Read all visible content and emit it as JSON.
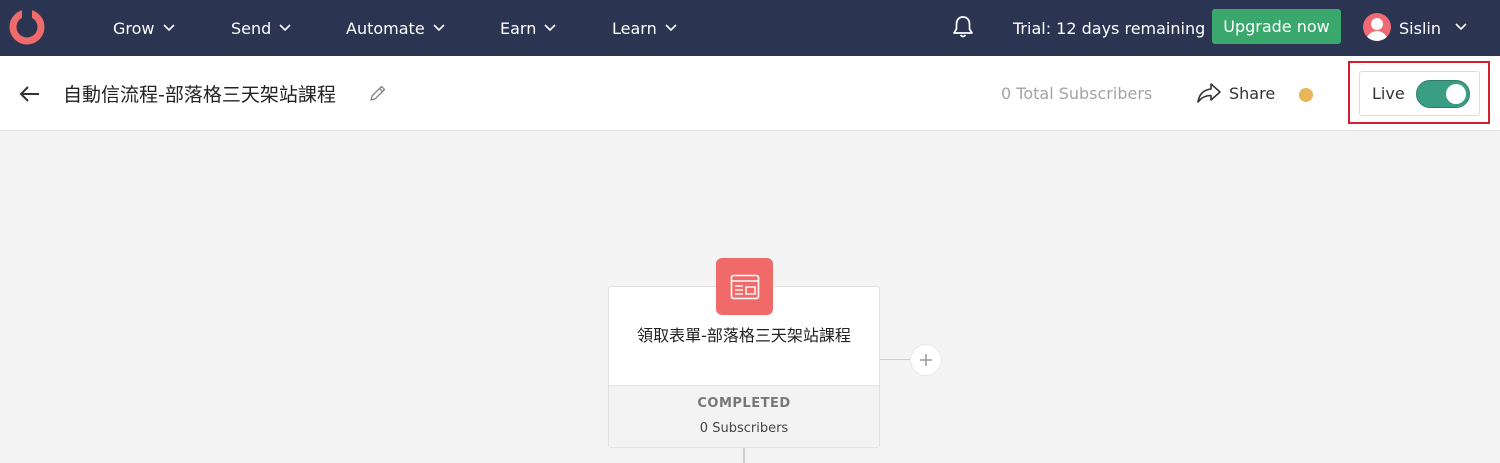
{
  "nav": {
    "items": [
      {
        "label": "Grow"
      },
      {
        "label": "Send"
      },
      {
        "label": "Automate"
      },
      {
        "label": "Earn"
      },
      {
        "label": "Learn"
      }
    ],
    "trial_text": "Trial: 12 days remaining",
    "upgrade_label": "Upgrade now",
    "user_name": "Sislin"
  },
  "header": {
    "sequence_title": "自動信流程-部落格三天架站課程",
    "subscribers_text": "0 Total Subscribers",
    "share_label": "Share",
    "live_label": "Live",
    "live_on": true
  },
  "node": {
    "title": "領取表單-部落格三天架站課程",
    "status": "COMPLETED",
    "subscribers": "0 Subscribers"
  },
  "colors": {
    "nav_bg": "#2b3551",
    "upgrade_green": "#3aa76d",
    "toggle_on": "#3a9e82",
    "node_icon": "#f06a6a",
    "status_dot": "#e8b558",
    "highlight_red": "#d2202f"
  }
}
